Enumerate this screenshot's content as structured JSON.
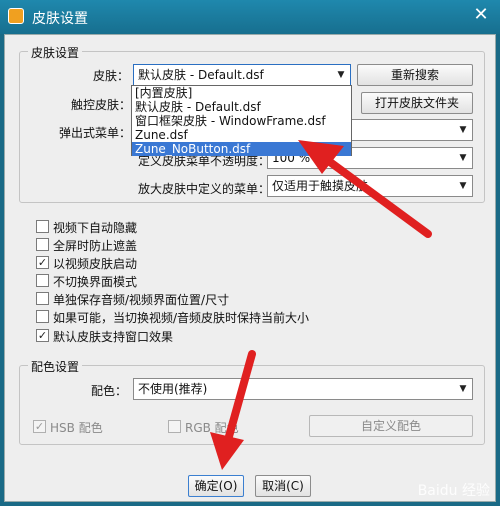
{
  "window": {
    "title": "皮肤设置",
    "close_glyph": "✕"
  },
  "skin_group": {
    "title": "皮肤设置",
    "skin_label": "皮肤：",
    "skin_value": "默认皮肤 - Default.dsf",
    "research_button": "重新搜索",
    "touch_skin_label": "触控皮肤：",
    "open_folder_button": "打开皮肤文件夹",
    "popup_menu_label": "弹出式菜单：",
    "custom_opacity_label": "定义皮肤菜单不透明度：",
    "custom_opacity_value": "100 %",
    "zoom_menu_label": "放大皮肤中定义的菜单：",
    "zoom_menu_value": "仅适用于触摸皮肤",
    "dropdown_options": [
      "[内置皮肤]",
      "默认皮肤 - Default.dsf",
      "窗口框架皮肤 - WindowFrame.dsf",
      "Zune.dsf",
      "Zune_NoButton.dsf"
    ]
  },
  "checkboxes": [
    {
      "label": "视频下自动隐藏",
      "checked": false
    },
    {
      "label": "全屏时防止遮盖",
      "checked": false
    },
    {
      "label": "以视频皮肤启动",
      "checked": true
    },
    {
      "label": "不切换界面模式",
      "checked": false
    },
    {
      "label": "单独保存音频/视频界面位置/尺寸",
      "checked": false
    },
    {
      "label": "如果可能，当切换视频/音频皮肤时保持当前大小",
      "checked": false
    },
    {
      "label": "默认皮肤支持窗口效果",
      "checked": true
    }
  ],
  "color_group": {
    "title": "配色设置",
    "color_label": "配色：",
    "color_value": "不使用(推荐)",
    "hsb_label": "HSB 配色",
    "rgb_label": "RGB 配色",
    "custom_button": "自定义配色"
  },
  "footer": {
    "ok_button": "确定(O)",
    "cancel_button": "取消(C)"
  },
  "colors": {
    "titlebar": "#1f88ad",
    "selection": "#3a78d4",
    "arrow": "#e02020"
  },
  "watermark": "Baidu 经验"
}
